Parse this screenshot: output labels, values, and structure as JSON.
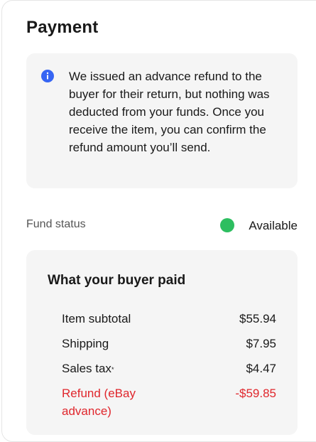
{
  "payment": {
    "title": "Payment",
    "notice": {
      "icon": "info-icon",
      "text": "We issued an advance refund to the buyer for their return, but nothing was deducted from your funds. Once you receive the item, you can confirm the refund amount you’ll send."
    },
    "fund_status": {
      "label": "Fund status",
      "value": "Available",
      "dot_color": "#2dbe60"
    },
    "buyer_paid": {
      "heading": "What your buyer paid",
      "rows": [
        {
          "label": "Item subtotal",
          "amount": "$55.94"
        },
        {
          "label": "Shipping",
          "amount": "$7.95"
        },
        {
          "label": "Sales tax",
          "marker": "*",
          "amount": "$4.47"
        },
        {
          "label": "Refund (eBay advance)",
          "amount": "-$59.85",
          "color": "#e0262c"
        }
      ]
    }
  }
}
